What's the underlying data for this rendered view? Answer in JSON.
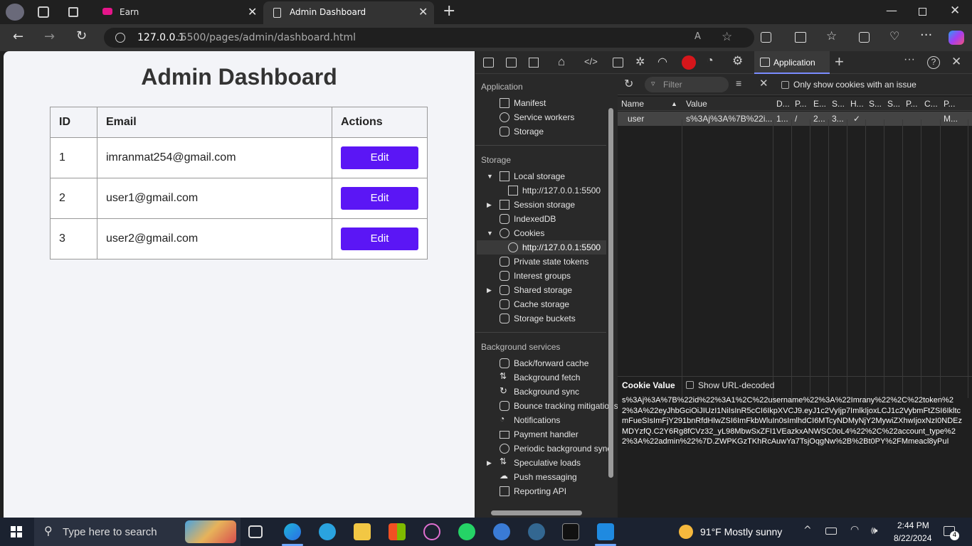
{
  "browser": {
    "tabs": [
      {
        "label": "Earn",
        "active": false
      },
      {
        "label": "Admin Dashboard",
        "active": true
      }
    ],
    "url_host": "127.0.0.1",
    "url_path": ":5500/pages/admin/dashboard.html"
  },
  "page": {
    "title": "Admin Dashboard",
    "columns": [
      "ID",
      "Email",
      "Actions"
    ],
    "rows": [
      {
        "id": "1",
        "email": "imranmat254@gmail.com",
        "action": "Edit"
      },
      {
        "id": "2",
        "email": "user1@gmail.com",
        "action": "Edit"
      },
      {
        "id": "3",
        "email": "user2@gmail.com",
        "action": "Edit"
      }
    ],
    "button_color": "#5b16f5"
  },
  "devtools": {
    "active_tab": "Application",
    "filter_placeholder": "Filter",
    "only_issue_label": "Only show cookies with an issue",
    "sidebar": {
      "application_header": "Application",
      "application_items": [
        "Manifest",
        "Service workers",
        "Storage"
      ],
      "storage_header": "Storage",
      "local_storage": "Local storage",
      "local_storage_origin": "http://127.0.0.1:5500",
      "session_storage": "Session storage",
      "indexeddb": "IndexedDB",
      "cookies": "Cookies",
      "cookies_origin": "http://127.0.0.1:5500",
      "storage_items": [
        "Private state tokens",
        "Interest groups",
        "Shared storage",
        "Cache storage",
        "Storage buckets"
      ],
      "background_header": "Background services",
      "background_items": [
        "Back/forward cache",
        "Background fetch",
        "Background sync",
        "Bounce tracking mitigations",
        "Notifications",
        "Payment handler",
        "Periodic background sync",
        "Speculative loads",
        "Push messaging",
        "Reporting API"
      ]
    },
    "cookie_table": {
      "headers": [
        "Name",
        "Value",
        "D...",
        "P...",
        "E...",
        "S...",
        "H...",
        "S...",
        "S...",
        "P...",
        "C...",
        "P..."
      ],
      "row": [
        "user",
        "s%3Aj%3A%7B%22i...",
        "1...",
        "/",
        "2...",
        "3...",
        "✓",
        "",
        "",
        "",
        "",
        "M..."
      ]
    },
    "cookie_value_label": "Cookie Value",
    "show_url_decoded": "Show URL-decoded",
    "cookie_value": "s%3Aj%3A%7B%22id%22%3A1%2C%22username%22%3A%22Imrany%22%2C%22token%22%3A%22eyJhbGciOiJIUzI1NiIsInR5cCI6IkpXVCJ9.eyJ1c2VyIjp7ImlkIjoxLCJ1c2VybmFtZSI6IkltcmFueSIsImFjY291bnRfdHlwZSI6ImFkbWluIn0sImlhdCI6MTcyNDMyNjY2MywiZXhwIjoxNzI0NDEzMDYzfQ.C2Y6Rg8fCVz32_yL98MbwSxZFI1VEazkxANWSC0oL4%22%2C%22account_type%22%3A%22admin%22%7D.ZWPKGzTKhRcAuwYa7TsjOqgNw%2B%2Bt0PY%2FMmeacl8yPuI"
  },
  "taskbar": {
    "search_placeholder": "Type here to search",
    "weather": "91°F  Mostly sunny",
    "time": "2:44 PM",
    "date": "8/22/2024",
    "notification_count": "4"
  }
}
